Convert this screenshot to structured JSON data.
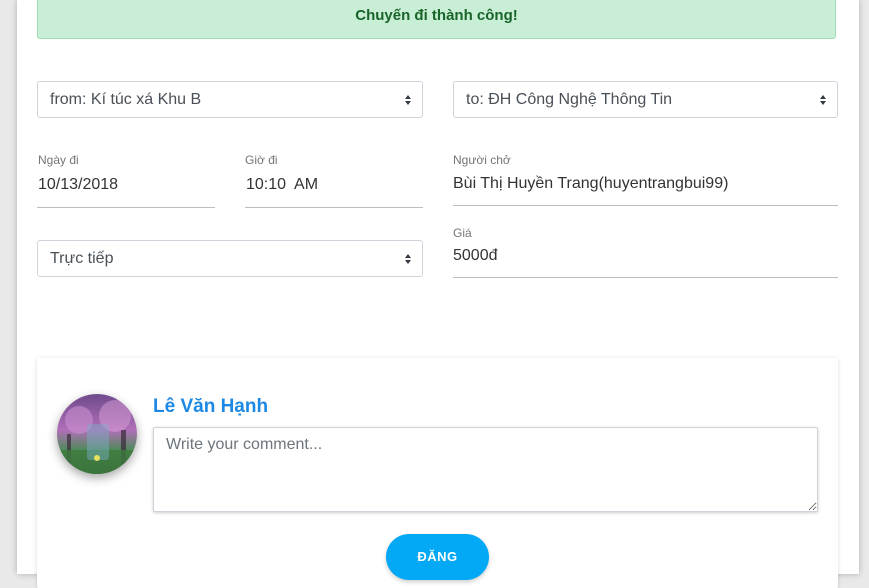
{
  "alert": {
    "message": "Chuyến đi thành công!"
  },
  "trip": {
    "from_select": "from: Kí túc xá Khu B",
    "to_select": "to: ĐH Công Nghệ Thông Tin",
    "date_label": "Ngày đi",
    "date_value": "10/13/2018",
    "time_label": "Giờ đi",
    "time_value": "10:10  AM",
    "driver_label": "Người chở",
    "driver_value": "Bùi Thị Huyền Trang(huyentrangbui99)",
    "method_select": "Trực tiếp",
    "price_label": "Giá",
    "price_value": "5000đ"
  },
  "comment": {
    "user_name": "Lê Văn Hạnh",
    "placeholder": "Write your comment...",
    "submit_label": "ĐĂNG"
  },
  "colors": {
    "alert_bg": "#c9eed6",
    "alert_text": "#186429",
    "username": "#1e88e5",
    "button": "#03a9f4"
  }
}
